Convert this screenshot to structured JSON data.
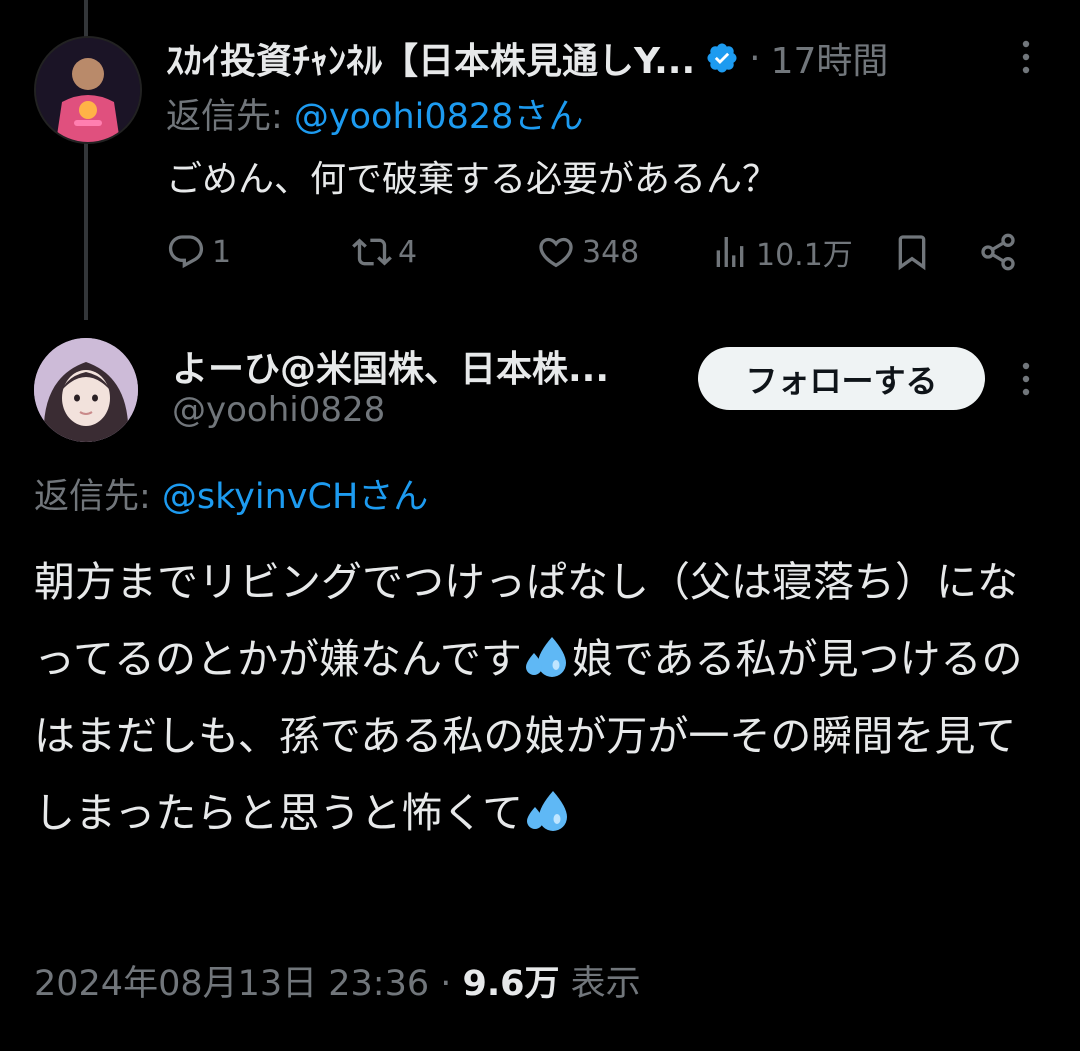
{
  "colors": {
    "background": "#000000",
    "text": "#e7e9ea",
    "secondary": "#71767b",
    "link": "#1d9bf0",
    "follow_bg": "#eff3f4"
  },
  "parent_tweet": {
    "display_name": "ｽｶｲ投資ﾁｬﾝﾈﾙ【日本株見通しY...",
    "verified_icon": "verified-badge-icon",
    "separator": "·",
    "time": "17時間",
    "reply_label": "返信先: ",
    "reply_handle": "@yoohi0828さん",
    "text": "ごめん、何で破棄する必要があるん？",
    "replies": "1",
    "reposts": "4",
    "likes": "348",
    "views": "10.1万"
  },
  "main_tweet": {
    "display_name": "よーひ@米国株、日本株...",
    "handle": "@yoohi0828",
    "follow_label": "フォローする",
    "reply_label": "返信先: ",
    "reply_handle": "@skyinvCHさん",
    "text_part1": "朝方までリビングでつけっぱなし（父は寝落ち）になってるのとかが嫌なんです",
    "text_part2": "娘である私が見つけるのはまだしも、孫である私の娘が万が一その瞬間を見てしまったらと思うと怖くて",
    "emoji_icon": "sweat-droplets-icon",
    "timestamp": "2024年08月13日 23:36",
    "meta_separator": " · ",
    "view_count": "9.6万",
    "view_label": " 表示"
  }
}
